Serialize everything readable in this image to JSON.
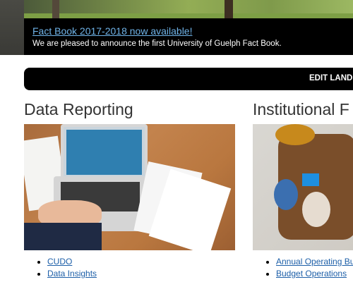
{
  "announcement": {
    "link_text": "Fact Book 2017-2018 now available!",
    "message": "We are pleased to announce the first University of Guelph Fact Book."
  },
  "toolbar": {
    "edit_label": "EDIT LANDI"
  },
  "sections": [
    {
      "title": "Data Reporting",
      "links": [
        "CUDO",
        "Data Insights"
      ]
    },
    {
      "title": "Institutional F",
      "links": [
        "Annual Operating Bu",
        "Budget Operations"
      ]
    }
  ],
  "colors": {
    "link": "#1d5fa8",
    "banner_link": "#6fb3e8",
    "banner_bg": "#000000"
  }
}
